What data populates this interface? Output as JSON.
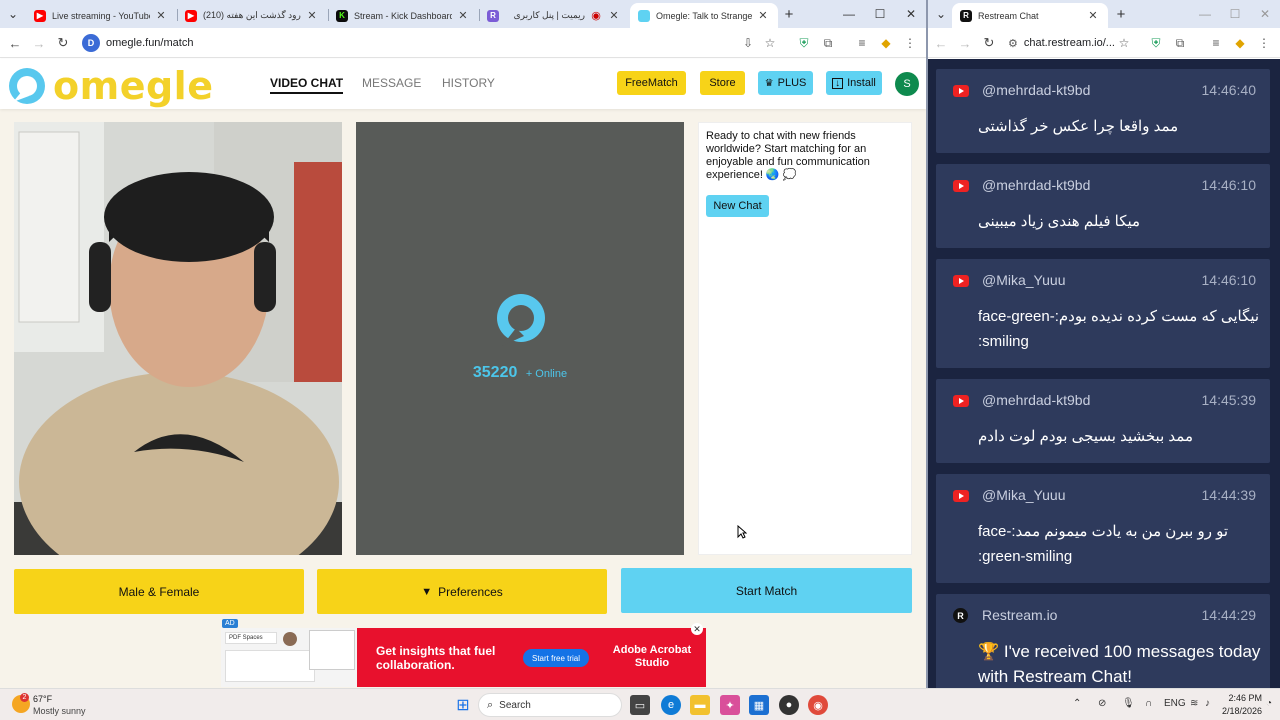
{
  "left_window": {
    "tabs": [
      {
        "label": "Live streaming - YouTube Studio",
        "icon": "youtube-icon",
        "color": "#ff0000"
      },
      {
        "label": "(210) ج رود گذشت این هفته",
        "icon": "youtube-icon",
        "color": "#ff0000"
      },
      {
        "label": "Stream - Kick Dashboard",
        "icon": "kick-icon",
        "color": "#53fc18"
      },
      {
        "label": "ریمیت | پنل کاربری",
        "icon": "r-icon",
        "color": "#7b5cd6"
      },
      {
        "label": "Omegle: Talk to Strangers",
        "icon": "omegle-icon",
        "color": "#5fd2f2",
        "active": true
      }
    ],
    "url": "omegle.fun/match"
  },
  "omegle": {
    "logo_text": "omegle",
    "nav": [
      {
        "label": "VIDEO CHAT",
        "active": true
      },
      {
        "label": "MESSAGE",
        "active": false
      },
      {
        "label": "HISTORY",
        "active": false
      }
    ],
    "header_buttons": {
      "freematch": "FreeMatch",
      "store": "Store",
      "plus": "PLUS",
      "install": "Install",
      "avatar_letter": "S"
    },
    "online_count": "35220",
    "online_label": "+ Online",
    "chat_intro": "Ready to chat with new friends worldwide? Start matching for an enjoyable and fun communication experience! 🌏 💭",
    "new_chat_label": "New Chat",
    "bottom_buttons": {
      "gender": "Male & Female",
      "preferences": "Preferences",
      "start": "Start Match"
    },
    "ad": {
      "badge": "AD",
      "headline": "Get insights that fuel collaboration.",
      "cta": "Start free trial",
      "brand": "Adobe Acrobat Studio",
      "doc_label": "PDF Spaces"
    }
  },
  "right_window": {
    "tab_label": "Restream Chat",
    "url": "chat.restream.io/...",
    "messages": [
      {
        "source": "youtube",
        "user": "@mehrdad-kt9bd",
        "time": "14:46:40",
        "text": "ممد واقعا چرا عکس خر گذاشتی"
      },
      {
        "source": "youtube",
        "user": "@mehrdad-kt9bd",
        "time": "14:46:10",
        "text": "میکا فیلم هندی زیاد میبینی"
      },
      {
        "source": "youtube",
        "user": "@Mika_Yuuu",
        "time": "14:46:10",
        "text": "نیگایی که مست کرده ندیده بودم:face-green-smiling:"
      },
      {
        "source": "youtube",
        "user": "@mehrdad-kt9bd",
        "time": "14:45:39",
        "text": "ممد ببخشید بسیجی بودم لوت دادم"
      },
      {
        "source": "youtube",
        "user": "@Mika_Yuuu",
        "time": "14:44:39",
        "text": "تو رو ببرن من به یادت میمونم ممد:face-green-smiling:"
      },
      {
        "source": "restream",
        "user": "Restream.io",
        "time": "14:44:29",
        "text": "🏆 I've received 100 messages today with Restream Chat!"
      }
    ]
  },
  "taskbar": {
    "weather_temp": "67°F",
    "weather_desc": "Mostly sunny",
    "weather_badge": "2",
    "search_placeholder": "Search",
    "lang": "ENG",
    "time": "2:46 PM",
    "date": "2/18/2026"
  }
}
